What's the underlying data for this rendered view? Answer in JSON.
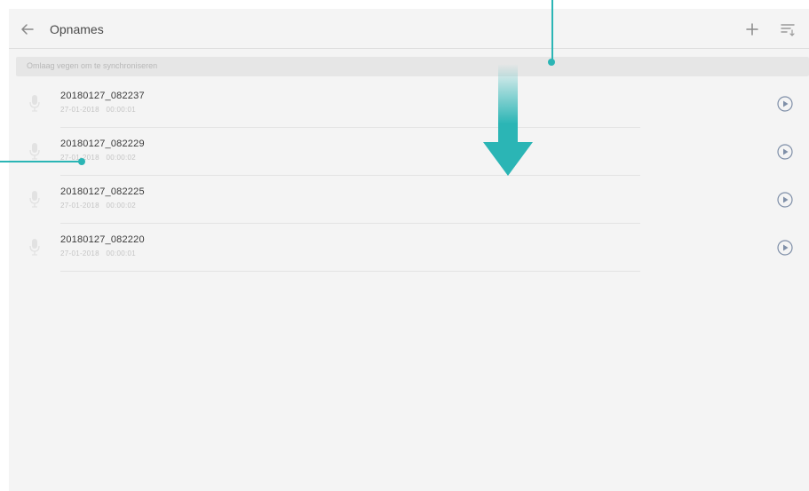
{
  "header": {
    "back_icon": "arrow-left-icon",
    "title": "Opnames",
    "add_icon": "plus-icon",
    "sort_icon": "sort-icon"
  },
  "hint": {
    "text": "Omlaag vegen om te synchroniseren"
  },
  "recordings": [
    {
      "name": "20180127_082237",
      "date": "27-01-2018",
      "duration": "00:00:01"
    },
    {
      "name": "20180127_082229",
      "date": "27-01-2018",
      "duration": "00:00:02"
    },
    {
      "name": "20180127_082225",
      "date": "27-01-2018",
      "duration": "00:00:02"
    },
    {
      "name": "20180127_082220",
      "date": "27-01-2018",
      "duration": "00:00:01"
    }
  ],
  "colors": {
    "accent": "#2bb5b5",
    "background": "#f4f4f4",
    "hint_bar": "#e6e6e6"
  }
}
